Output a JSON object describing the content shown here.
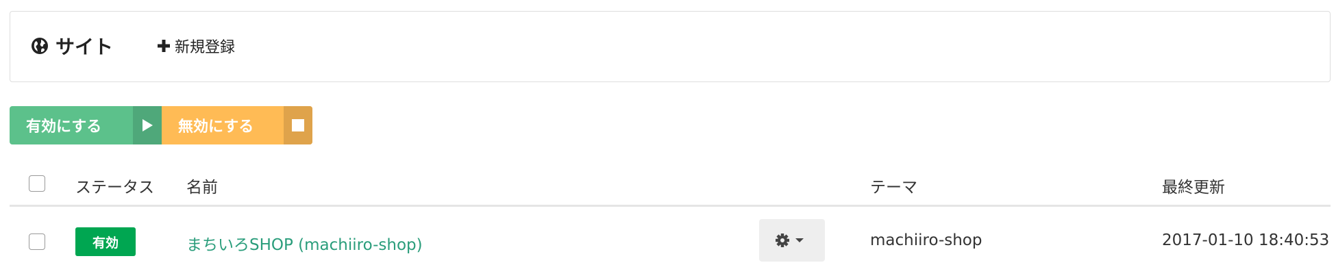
{
  "header": {
    "title": "サイト",
    "title_icon": "globe-icon",
    "new_label": "新規登録",
    "new_icon": "plus-icon"
  },
  "bulk_actions": {
    "enable_label": "有効にする",
    "enable_icon": "play-icon",
    "enable_color": "#5cc18b",
    "disable_label": "無効にする",
    "disable_icon": "stop-icon",
    "disable_color": "#ffbb55"
  },
  "table": {
    "columns": [
      "ステータス",
      "名前",
      "テーマ",
      "最終更新"
    ],
    "rows": [
      {
        "status": "有効",
        "status_color": "#00a651",
        "name": "まちいろSHOP (machiiro-shop)",
        "theme": "machiiro-shop",
        "updated": "2017-01-10 18:40:53",
        "checked": false
      }
    ]
  }
}
